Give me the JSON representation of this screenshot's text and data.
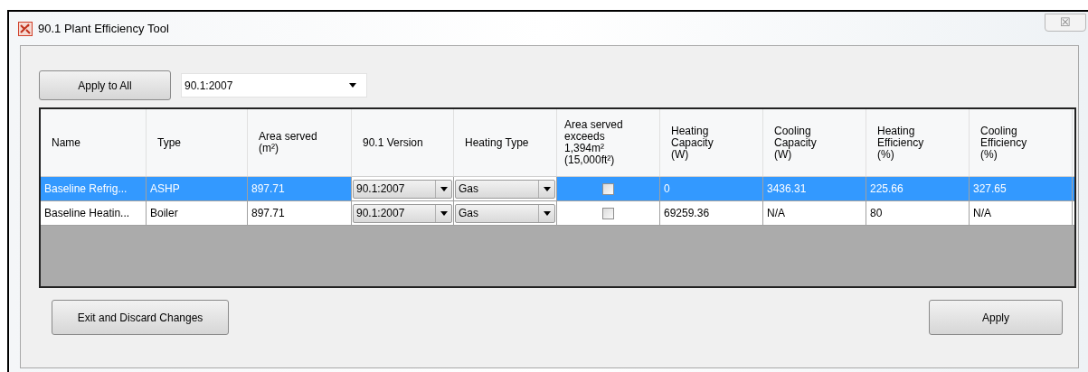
{
  "window": {
    "title": "90.1 Plant Efficiency Tool",
    "close": "☒"
  },
  "toolbar": {
    "apply_all_button": "Apply to All",
    "version_select": "90.1:2007"
  },
  "table": {
    "columns": [
      "Name",
      "Type",
      "Area served\n(m²)",
      "90.1 Version",
      "Heating Type",
      "Area served\nexceeds\n1,394m²\n(15,000ft²)",
      "Heating\nCapacity\n(W)",
      "Cooling\nCapacity\n(W)",
      "Heating\nEfficiency\n(%)",
      "Cooling\nEfficiency\n(%)"
    ],
    "rows": [
      {
        "selected": true,
        "name": "Baseline Refrig...",
        "type": "ASHP",
        "area": "897.71",
        "version": "90.1:2007",
        "heating_type": "Gas",
        "exceeds": false,
        "heating_capacity": "0",
        "cooling_capacity": "3436.31",
        "heating_efficiency": "225.66",
        "cooling_efficiency": "327.65"
      },
      {
        "selected": false,
        "name": "Baseline Heatin...",
        "type": "Boiler",
        "area": "897.71",
        "version": "90.1:2007",
        "heating_type": "Gas",
        "exceeds": false,
        "heating_capacity": "69259.36",
        "cooling_capacity": "N/A",
        "heating_efficiency": "80",
        "cooling_efficiency": "N/A"
      }
    ]
  },
  "buttons": {
    "discard": "Exit and Discard Changes",
    "apply": "Apply"
  }
}
